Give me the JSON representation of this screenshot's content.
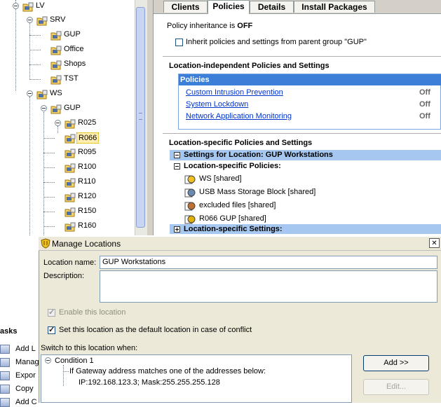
{
  "tree": {
    "nodes": [
      {
        "label": "LV"
      },
      {
        "label": "SRV"
      },
      {
        "label": "GUP"
      },
      {
        "label": "Office"
      },
      {
        "label": "Shops"
      },
      {
        "label": "TST"
      },
      {
        "label": "WS"
      },
      {
        "label": "GUP"
      },
      {
        "label": "R025"
      },
      {
        "label": "R066",
        "selected": true
      },
      {
        "label": "R095"
      },
      {
        "label": "R100"
      },
      {
        "label": "R110"
      },
      {
        "label": "R120"
      },
      {
        "label": "R150"
      },
      {
        "label": "R160"
      }
    ]
  },
  "tabs": [
    "Clients",
    "Policies",
    "Details",
    "Install Packages"
  ],
  "active_tab": "Policies",
  "policies": {
    "inheritance_prefix": "Policy inheritance is ",
    "inheritance_state": "OFF",
    "inherit_checkbox_label": "Inherit policies and settings from parent group \"GUP\"",
    "inherit_checked": false,
    "location_independent_heading": "Location-independent Policies and Settings",
    "policies_header": "Policies",
    "independent_items": [
      {
        "name": "Custom Intrusion Prevention",
        "state": "Off"
      },
      {
        "name": "System Lockdown",
        "state": "Off"
      },
      {
        "name": "Network Application Monitoring",
        "state": "Off"
      }
    ],
    "location_specific_heading": "Location-specific Policies and Settings",
    "settings_for_location": "Settings for Location: GUP Workstations",
    "location_specific_policies_label": "Location-specific Policies:",
    "specific_items": [
      {
        "name": "WS [shared]",
        "icon": "firewall-icon"
      },
      {
        "name": "USB Mass Storage Block [shared]",
        "icon": "device-control-icon"
      },
      {
        "name": "excluded files [shared]",
        "icon": "exceptions-icon"
      },
      {
        "name": "R066 GUP [shared]",
        "icon": "liveupdate-icon"
      }
    ],
    "location_specific_settings_label": "Location-specific Settings:"
  },
  "dialog": {
    "title": "Manage Locations",
    "close_glyph": "✕",
    "location_name_label": "Location name:",
    "location_name_value": "GUP Workstations",
    "description_label": "Description:",
    "description_value": "",
    "enable_label": "Enable this location",
    "enable_checked": true,
    "default_label": "Set this location as the default location in case of conflict",
    "default_checked": true,
    "switch_label": "Switch to this location when:",
    "condition_title": "Condition 1",
    "condition_text": "If Gateway address matches one of the addresses below:",
    "condition_value": "IP:192.168.123.3; Mask:255.255.255.128",
    "add_button": "Add >>",
    "edit_button": "Edit..."
  },
  "tasks": {
    "heading": "asks",
    "items": [
      "Add L",
      "Manag",
      "Expor",
      "Copy",
      "Add C"
    ]
  },
  "colors": {
    "policies_header_bg": "#3c7fd9",
    "settings_row_bg": "#a6c8f0",
    "selection_bg": "#ffeeb0",
    "dialog_bg": "#ece9d8"
  }
}
